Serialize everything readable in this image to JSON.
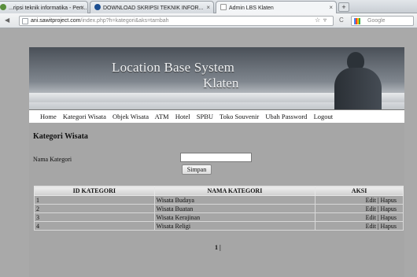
{
  "browser": {
    "tabs": [
      {
        "label": "...ripsi teknik informatika - Pen...",
        "active": false,
        "favicon_color": "#5a8f3c"
      },
      {
        "label": "DOWNLOAD SKRIPSI TEKNIK INFOR...",
        "active": false,
        "favicon_color": "#1d4f91"
      },
      {
        "label": "Admin LBS Klaten",
        "active": true,
        "favicon_color": "#ffffff"
      }
    ],
    "new_tab_label": "+",
    "url_host": "ani.sawitproject.com",
    "url_path": "/index.php?h=kategori&aks=tambah",
    "search_engine": "Google"
  },
  "banner": {
    "title_line1": "Location Base System",
    "title_line2": "Klaten"
  },
  "menu": [
    "Home",
    "Kategori Wisata",
    "Objek Wisata",
    "ATM",
    "Hotel",
    "SPBU",
    "Toko Souvenir",
    "Ubah Password",
    "Logout"
  ],
  "form": {
    "title": "Kategori Wisata",
    "field_label": "Nama Kategori",
    "field_value": "",
    "save_label": "Simpan"
  },
  "table": {
    "headers": [
      "ID KATEGORI",
      "NAMA KATEGORI",
      "AKSI"
    ],
    "rows": [
      {
        "id": "1",
        "name": "Wisata Budaya",
        "edit": "Edit",
        "sep": "|",
        "delete": "Hapus"
      },
      {
        "id": "2",
        "name": "Wisata Buatan",
        "edit": "Edit",
        "sep": "|",
        "delete": "Hapus"
      },
      {
        "id": "3",
        "name": "Wisata Kerajinan",
        "edit": "Edit",
        "sep": "|",
        "delete": "Hapus"
      },
      {
        "id": "4",
        "name": "Wisata Religi",
        "edit": "Edit",
        "sep": "|",
        "delete": "Hapus"
      }
    ]
  },
  "pager": "1 |"
}
